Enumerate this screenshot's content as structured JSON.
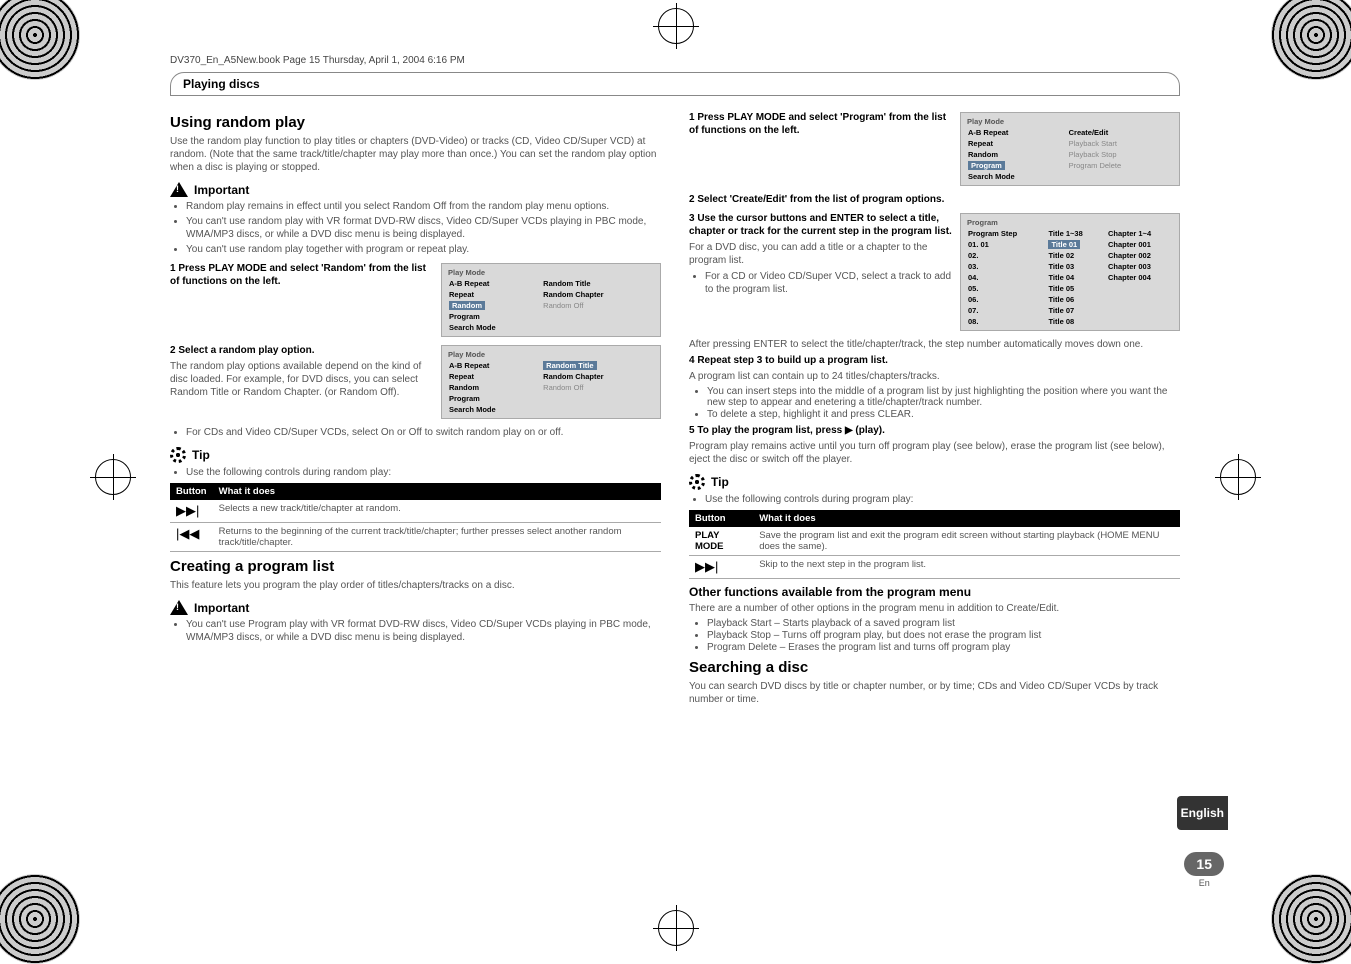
{
  "book_header": "DV370_En_A5New.book  Page 15  Thursday, April 1, 2004  6:16 PM",
  "section_title": "Playing discs",
  "left": {
    "h1": "Using random play",
    "intro": "Use the random play function to play titles or chapters (DVD-Video) or tracks (CD, Video CD/Super VCD) at random. (Note that the same track/title/chapter may play more than once.) You can set the random play option when a disc is playing or stopped.",
    "important_label": "Important",
    "important_items": [
      "Random play remains in effect until you select Random Off from the random play menu options.",
      "You can't use random play with VR format DVD-RW discs, Video CD/Super VCDs playing in PBC mode, WMA/MP3 discs, or while a DVD disc menu is being displayed.",
      "You can't use random play together with program or repeat play."
    ],
    "step1": "1    Press PLAY MODE and select 'Random' from the list of functions on the left.",
    "osd1": {
      "title": "Play Mode",
      "rows": [
        [
          "A-B Repeat",
          "Random Title"
        ],
        [
          "Repeat",
          "Random Chapter"
        ],
        [
          "Random",
          "Random Off"
        ],
        [
          "Program",
          ""
        ],
        [
          "Search Mode",
          ""
        ]
      ],
      "highlight_left": "Random",
      "grey_right": "Random Off"
    },
    "step2_head": "2    Select a random play option.",
    "step2_body": "The random play options available depend on the kind of disc loaded. For example, for DVD discs, you can select Random Title or Random Chapter. (or Random Off).",
    "osd2": {
      "title": "Play Mode",
      "rows": [
        [
          "A-B Repeat",
          "Random Title"
        ],
        [
          "Repeat",
          "Random Chapter"
        ],
        [
          "Random",
          "Random Off"
        ],
        [
          "Program",
          ""
        ],
        [
          "Search Mode",
          ""
        ]
      ],
      "highlight_right": "Random Title",
      "grey_right": "Random Off"
    },
    "step2_bullet": "For CDs and Video CD/Super VCDs, select On or Off to switch random play on or off.",
    "tip_label": "Tip",
    "tip_intro": "Use the following controls during random play:",
    "table": {
      "head": [
        "Button",
        "What it does"
      ],
      "rows": [
        [
          "▶▶|",
          "Selects a new track/title/chapter at random."
        ],
        [
          "|◀◀",
          "Returns to the beginning of the current track/title/chapter; further presses select another random track/title/chapter."
        ]
      ]
    },
    "h2": "Creating a program list",
    "h2_intro": "This feature lets you program the play order of titles/chapters/tracks on a disc.",
    "important2_label": "Important",
    "important2_items": [
      "You can't use Program play with VR format DVD-RW discs, Video CD/Super VCDs playing in PBC mode, WMA/MP3 discs, or while a DVD disc menu is being displayed."
    ]
  },
  "right": {
    "step1": "1    Press PLAY MODE and select 'Program' from the list of functions on the left.",
    "osd1": {
      "title": "Play Mode",
      "rows": [
        [
          "A-B Repeat",
          "Create/Edit"
        ],
        [
          "Repeat",
          "Playback Start"
        ],
        [
          "Random",
          "Playback Stop"
        ],
        [
          "Program",
          "Program Delete"
        ],
        [
          "Search Mode",
          ""
        ]
      ],
      "highlight_left": "Program",
      "grey_items": [
        "Playback Start",
        "Playback Stop",
        "Program Delete"
      ]
    },
    "step2": "2    Select 'Create/Edit' from the list of program options.",
    "step3_head": "3    Use the cursor buttons and ENTER to select a title, chapter or track for the current step in the program list.",
    "step3_body": "For a DVD disc, you can add a title or a chapter to the program list.",
    "step3_bullet": "For a  CD or Video CD/Super VCD, select a track to add to the program list.",
    "osd2": {
      "title": "Program",
      "head": [
        "Program Step",
        "Title 1~38",
        "Chapter 1~4"
      ],
      "rows": [
        [
          "01. 01",
          "Title 01",
          "Chapter 001"
        ],
        [
          "02.",
          "Title 02",
          "Chapter 002"
        ],
        [
          "03.",
          "Title 03",
          "Chapter 003"
        ],
        [
          "04.",
          "Title 04",
          "Chapter 004"
        ],
        [
          "05.",
          "Title 05",
          ""
        ],
        [
          "06.",
          "Title 06",
          ""
        ],
        [
          "07.",
          "Title 07",
          ""
        ],
        [
          "08.",
          "Title 08",
          ""
        ]
      ]
    },
    "after_enter": "After pressing ENTER to select the title/chapter/track, the step number automatically moves down one.",
    "step4_head": "4    Repeat step 3 to build up a program list.",
    "step4_body": "A program list can contain up to 24 titles/chapters/tracks.",
    "step4_bullets": [
      "You can insert steps into the middle of a program list by just highlighting the position where you want the new step to appear and enetering a title/chapter/track number.",
      "To delete a step, highlight it and press CLEAR."
    ],
    "step5": "5    To play the program list, press ▶ (play).",
    "step5_body": "Program play remains active until you turn off program play (see below), erase the program list (see below), eject the disc or switch off the player.",
    "tip_label": "Tip",
    "tip_intro": "Use the following controls during program play:",
    "table": {
      "head": [
        "Button",
        "What it does"
      ],
      "rows": [
        [
          "PLAY MODE",
          "Save the program list and exit the program edit screen without starting playback (HOME MENU does the same)."
        ],
        [
          "▶▶|",
          "Skip to the next step in the program list."
        ]
      ]
    },
    "other_h": "Other functions available from the program menu",
    "other_intro": "There are a number of other options in the program menu in addition to Create/Edit.",
    "other_bullets": [
      "Playback Start – Starts playback of a saved program list",
      "Playback Stop – Turns off program play, but does not erase the program list",
      "Program Delete – Erases the program list and turns off program play"
    ],
    "search_h": "Searching a disc",
    "search_body": "You can search DVD discs by title or chapter number, or by time; CDs and Video CD/Super VCDs by track number or time."
  },
  "side_tab": "English",
  "page_num": "15",
  "page_lang": "En"
}
